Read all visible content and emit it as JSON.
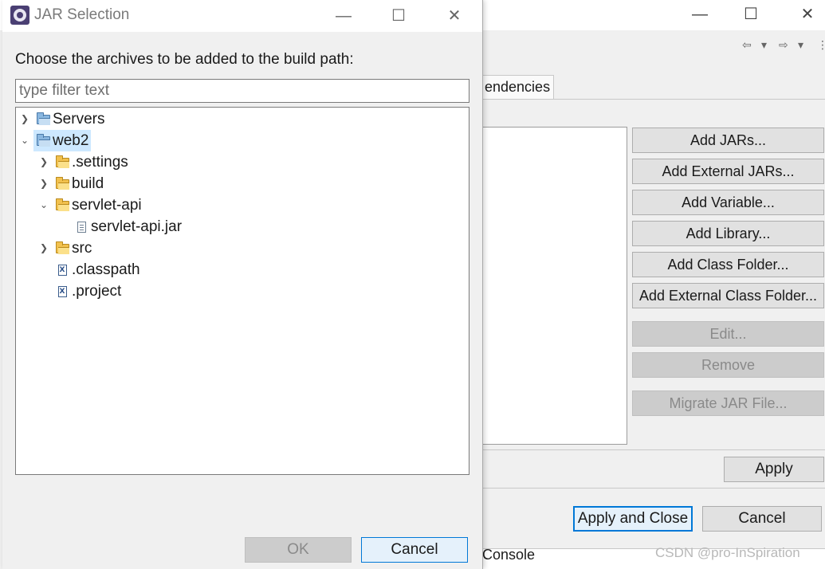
{
  "background_window": {
    "tab_partial_label": "endencies",
    "side_buttons": [
      {
        "label": "Add JARs...",
        "enabled": true
      },
      {
        "label": "Add External JARs...",
        "enabled": true
      },
      {
        "label": "Add Variable...",
        "enabled": true
      },
      {
        "label": "Add Library...",
        "enabled": true
      },
      {
        "label": "Add Class Folder...",
        "enabled": true
      },
      {
        "label": "Add External Class Folder...",
        "enabled": true
      },
      {
        "label": "Edit...",
        "enabled": false
      },
      {
        "label": "Remove",
        "enabled": false
      },
      {
        "label": "Migrate JAR File...",
        "enabled": false
      }
    ],
    "apply_label": "Apply",
    "apply_and_close_label": "Apply and Close",
    "cancel_label": "Cancel",
    "console_label": "Console",
    "watermark": "CSDN @pro-InSpiration",
    "nav": {
      "back_icon": "⇦",
      "forward_icon": "⇨",
      "dropdown_icon": "▾",
      "more_icon": "⋮"
    }
  },
  "dialog": {
    "title": "JAR Selection",
    "window_controls": {
      "minimize": "—",
      "maximize": "☐",
      "close": "✕"
    },
    "prompt": "Choose the archives to be added to the build path:",
    "filter_placeholder": "type filter text",
    "tree": [
      {
        "label": "Servers",
        "depth": 0,
        "expanded": false,
        "icon": "project-folder-icon",
        "selected": false
      },
      {
        "label": "web2",
        "depth": 0,
        "expanded": true,
        "icon": "project-folder-icon",
        "selected": true
      },
      {
        "label": ".settings",
        "depth": 1,
        "expanded": false,
        "icon": "folder-icon",
        "selected": false
      },
      {
        "label": "build",
        "depth": 1,
        "expanded": false,
        "icon": "folder-icon",
        "selected": false
      },
      {
        "label": "servlet-api",
        "depth": 1,
        "expanded": true,
        "icon": "folder-icon",
        "selected": false
      },
      {
        "label": "servlet-api.jar",
        "depth": 2,
        "expanded": null,
        "icon": "jar-file-icon",
        "selected": false
      },
      {
        "label": "src",
        "depth": 1,
        "expanded": false,
        "icon": "folder-icon",
        "selected": false
      },
      {
        "label": ".classpath",
        "depth": 1,
        "expanded": null,
        "icon": "xml-file-icon",
        "selected": false
      },
      {
        "label": ".project",
        "depth": 1,
        "expanded": null,
        "icon": "xml-file-icon",
        "selected": false
      }
    ],
    "ok_label": "OK",
    "cancel_label": "Cancel"
  }
}
